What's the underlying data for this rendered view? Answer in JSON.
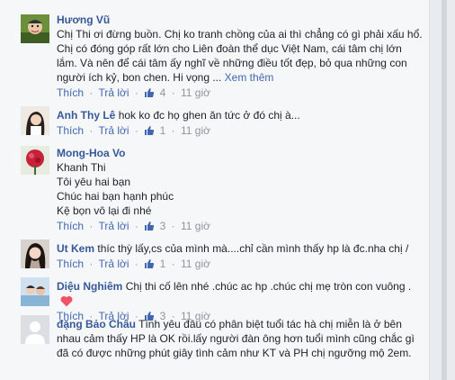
{
  "ui": {
    "like_label": "Thích",
    "reply_label": "Trả lời",
    "dot": "·",
    "see_more": "Xem thêm"
  },
  "comments": [
    {
      "name": "Hương Vũ",
      "text": "Chị Thi ơi đừng buồn. Chị ko tranh chồng của ai thì chẳng có gì phải xấu hổ. Chị có đóng góp rất lớn cho Liên đoàn thể dục Việt Nam, cái tâm chị lớn lắm. Và nên để cái tâm ấy nghĩ về những điều tốt đẹp, bỏ qua những con người ích kỷ, bon chen. Hi vọng ...",
      "likes": "4",
      "time": "11 giờ"
    },
    {
      "name": "Anh Thy Lê",
      "text": "hok ko đc họ ghen ăn tức ở đó chị à...",
      "likes": "1",
      "time": "11 giờ"
    },
    {
      "name": "Mong-Hoa Vo",
      "lines": [
        "Khanh Thi",
        "Tôi yêu hai bạn",
        "Chúc hai bạn hạnh phúc",
        "Kệ bọn vô lại đi nhé"
      ],
      "likes": "3",
      "time": "11 giờ"
    },
    {
      "name": "Ut Kem",
      "text": "thíc thỳ lấy,cs của mình mà....chỉ cần mình thấy hp là đc.nha chị /",
      "likes": "1",
      "time": "11 giờ"
    },
    {
      "name": "Diệu Nghiêm",
      "text": "Chị thi cố lên nhé .chúc ac hp .chúc chị mẹ tròn con vuông .",
      "likes": "3",
      "time": "11 giờ"
    },
    {
      "name": "đặng Bảo Châu",
      "text": "Tình yêu đâu có phân biệt tuổi tác hà chị miễn là ở bên nhau cảm thấy HP là OK rồi.lấy người đàn ông hơn tuổi mình cũng chắc gì đã có được những phút giây tình cảm như KT và PH chị ngưỡng mộ 2em."
    }
  ]
}
